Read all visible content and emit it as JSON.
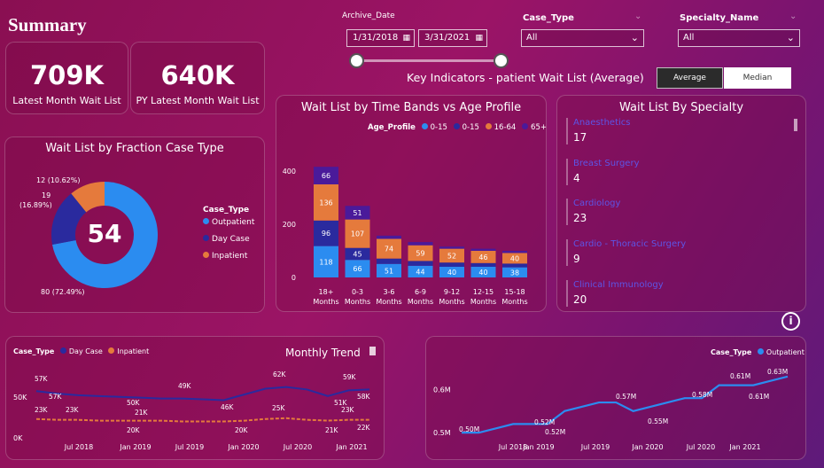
{
  "page": {
    "title": "Summary"
  },
  "kpis": [
    {
      "value": "709K",
      "label": "Latest Month Wait List"
    },
    {
      "value": "640K",
      "label": "PY Latest Month Wait List"
    }
  ],
  "archive_date": {
    "label": "Archive_Date",
    "start": "1/31/2018",
    "end": "3/31/2021"
  },
  "case_type_slicer": {
    "label": "Case_Type",
    "value": "All"
  },
  "specialty_slicer": {
    "label": "Specialty_Name",
    "value": "All"
  },
  "key_indicators": {
    "label": "Key Indicators - patient Wait List (Average)",
    "average": "Average",
    "median": "Median"
  },
  "fraction": {
    "title": "Wait List by Fraction Case Type",
    "center_value": "54",
    "legend_title": "Case_Type",
    "legend": [
      "Outpatient",
      "Day Case",
      "Inpatient"
    ],
    "labels": {
      "outpatient": "80 (72.49%)",
      "daycase_a": "19",
      "daycase_b": "(16.89%)",
      "inpatient": "12 (10.62%)"
    }
  },
  "timebands": {
    "title": "Wait List by Time Bands vs Age Profile",
    "legend_title": "Age_Profile",
    "legend": [
      "0-15",
      "0-15",
      "16-64",
      "65+"
    ]
  },
  "specialty": {
    "title": "Wait List By Specialty",
    "items": [
      {
        "name": "Anaesthetics",
        "value": "17"
      },
      {
        "name": "Breast Surgery",
        "value": "4"
      },
      {
        "name": "Cardiology",
        "value": "23"
      },
      {
        "name": "Cardio - Thoracic Surgery",
        "value": "9"
      },
      {
        "name": "Clinical Immunology",
        "value": "20"
      }
    ]
  },
  "monthly": {
    "title": "Monthly Trend",
    "legend_title": "Case_Type",
    "legend": [
      "Day Case",
      "Inpatient"
    ]
  },
  "outpatient_trend": {
    "legend_title": "Case_Type",
    "legend": [
      "Outpatient"
    ]
  },
  "info_icon": "i",
  "colors": {
    "outpatient": "#2b8cf0",
    "daycase": "#2a2a9e",
    "inpatient": "#e57a3c",
    "age65": "#4a1a9a"
  },
  "chart_data": [
    {
      "type": "pie",
      "title": "Wait List by Fraction Case Type",
      "categories": [
        "Outpatient",
        "Day Case",
        "Inpatient"
      ],
      "values": [
        80,
        19,
        12
      ],
      "percent": [
        72.49,
        16.89,
        10.62
      ]
    },
    {
      "type": "bar",
      "title": "Wait List by Time Bands vs Age Profile",
      "categories": [
        "18+ Months",
        "0-3 Months",
        "3-6 Months",
        "6-9 Months",
        "9-12 Months",
        "12-15 Months",
        "15-18 Months"
      ],
      "series": [
        {
          "name": "0-15",
          "values": [
            118,
            66,
            51,
            44,
            40,
            40,
            38
          ]
        },
        {
          "name": "0-15",
          "values": [
            96,
            45,
            20,
            18,
            16,
            14,
            14
          ]
        },
        {
          "name": "16-64",
          "values": [
            136,
            107,
            74,
            59,
            52,
            46,
            40
          ]
        },
        {
          "name": "65+",
          "values": [
            66,
            51,
            12,
            12,
            8,
            8,
            8
          ]
        }
      ],
      "yticks": [
        "400",
        "200",
        "0"
      ],
      "ylim": [
        0,
        420
      ]
    },
    {
      "type": "line",
      "title": "Monthly Trend",
      "xticks": [
        "Jul 2018",
        "Jan 2019",
        "Jul 2019",
        "Jan 2020",
        "Jul 2020",
        "Jan 2021"
      ],
      "yticks": [
        "50K",
        "0K"
      ],
      "series": [
        {
          "name": "Day Case",
          "values": [
            57,
            54,
            52,
            51,
            50,
            49,
            48,
            48,
            47,
            46,
            53,
            60,
            62,
            59,
            51,
            58,
            59
          ]
        },
        {
          "name": "Inpatient",
          "values": [
            23,
            22,
            22,
            21,
            21,
            21,
            21,
            20,
            20,
            20,
            21,
            23,
            24,
            22,
            21,
            22,
            22
          ]
        }
      ],
      "labels": [
        "57K",
        "57K",
        "50K",
        "49K",
        "46K",
        "62K",
        "51K",
        "59K",
        "58K",
        "23K",
        "23K",
        "21K",
        "20K",
        "20K",
        "25K",
        "21K",
        "23K",
        "22K"
      ]
    },
    {
      "type": "line",
      "title": "",
      "xticks": [
        "Jul 2018",
        "Jan 2019",
        "Jul 2019",
        "Jan 2020",
        "Jul 2020",
        "Jan 2021"
      ],
      "yticks": [
        "0.6M",
        "0.5M"
      ],
      "series": [
        {
          "name": "Outpatient",
          "values": [
            0.5,
            0.5,
            0.51,
            0.52,
            0.52,
            0.52,
            0.55,
            0.56,
            0.57,
            0.57,
            0.55,
            0.56,
            0.57,
            0.58,
            0.58,
            0.61,
            0.61,
            0.61,
            0.62,
            0.63
          ]
        }
      ],
      "labels": [
        "0.50M",
        "0.52M",
        "0.52M",
        "0.57M",
        "0.55M",
        "0.58M",
        "0.61M",
        "0.61M",
        "0.63M"
      ]
    }
  ]
}
